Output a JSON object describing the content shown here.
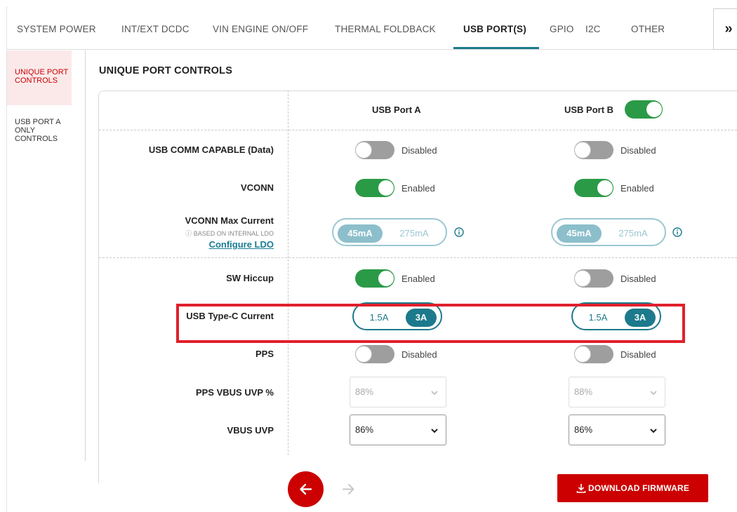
{
  "tabs": [
    {
      "label": "SYSTEM POWER"
    },
    {
      "label": "INT/EXT DCDC"
    },
    {
      "label": "VIN ENGINE ON/OFF"
    },
    {
      "label": "THERMAL FOLDBACK"
    },
    {
      "label": "USB PORT(S)",
      "active": true
    },
    {
      "label": "GPIO"
    },
    {
      "label": "I2C"
    },
    {
      "label": "OTHER"
    }
  ],
  "tabs_more_icon": "chevron-double-right-icon",
  "sidebar": {
    "items": [
      {
        "label": "UNIQUE PORT CONTROLS",
        "active": true
      },
      {
        "label": "USB PORT A ONLY CONTROLS"
      }
    ]
  },
  "section_title": "UNIQUE PORT CONTROLS",
  "columns": {
    "port_a": "USB Port A",
    "port_b": "USB Port B",
    "port_b_enabled": true
  },
  "rows": {
    "usb_comm": {
      "label": "USB COMM CAPABLE (Data)",
      "a": "Disabled",
      "b": "Disabled"
    },
    "vconn": {
      "label": "VCONN",
      "a": "Enabled",
      "b": "Enabled"
    },
    "vconn_max": {
      "label": "VCONN Max Current",
      "note": "BASED ON INTERNAL LDO",
      "link": "Configure LDO",
      "options": [
        "45mA",
        "275mA"
      ],
      "a_selected": "45mA",
      "b_selected": "45mA"
    },
    "sw_hiccup": {
      "label": "SW Hiccup",
      "a": "Enabled",
      "b": "Disabled"
    },
    "type_c_current": {
      "label": "USB Type-C Current",
      "options": [
        "1.5A",
        "3A"
      ],
      "a_selected": "3A",
      "b_selected": "3A"
    },
    "pps": {
      "label": "PPS",
      "a": "Disabled",
      "b": "Disabled"
    },
    "pps_vbus_uvp": {
      "label": "PPS VBUS UVP %",
      "a": "88%",
      "b": "88%",
      "disabled": true
    },
    "vbus_uvp": {
      "label": "VBUS UVP",
      "a": "86%",
      "b": "86%"
    }
  },
  "footer": {
    "download_label": "DOWNLOAD FIRMWARE"
  },
  "colors": {
    "accent_red": "#cc0000",
    "teal": "#1c7a8c",
    "toggle_on": "#2a9a47",
    "toggle_off": "#9e9e9e",
    "highlight": "#e0202c"
  }
}
